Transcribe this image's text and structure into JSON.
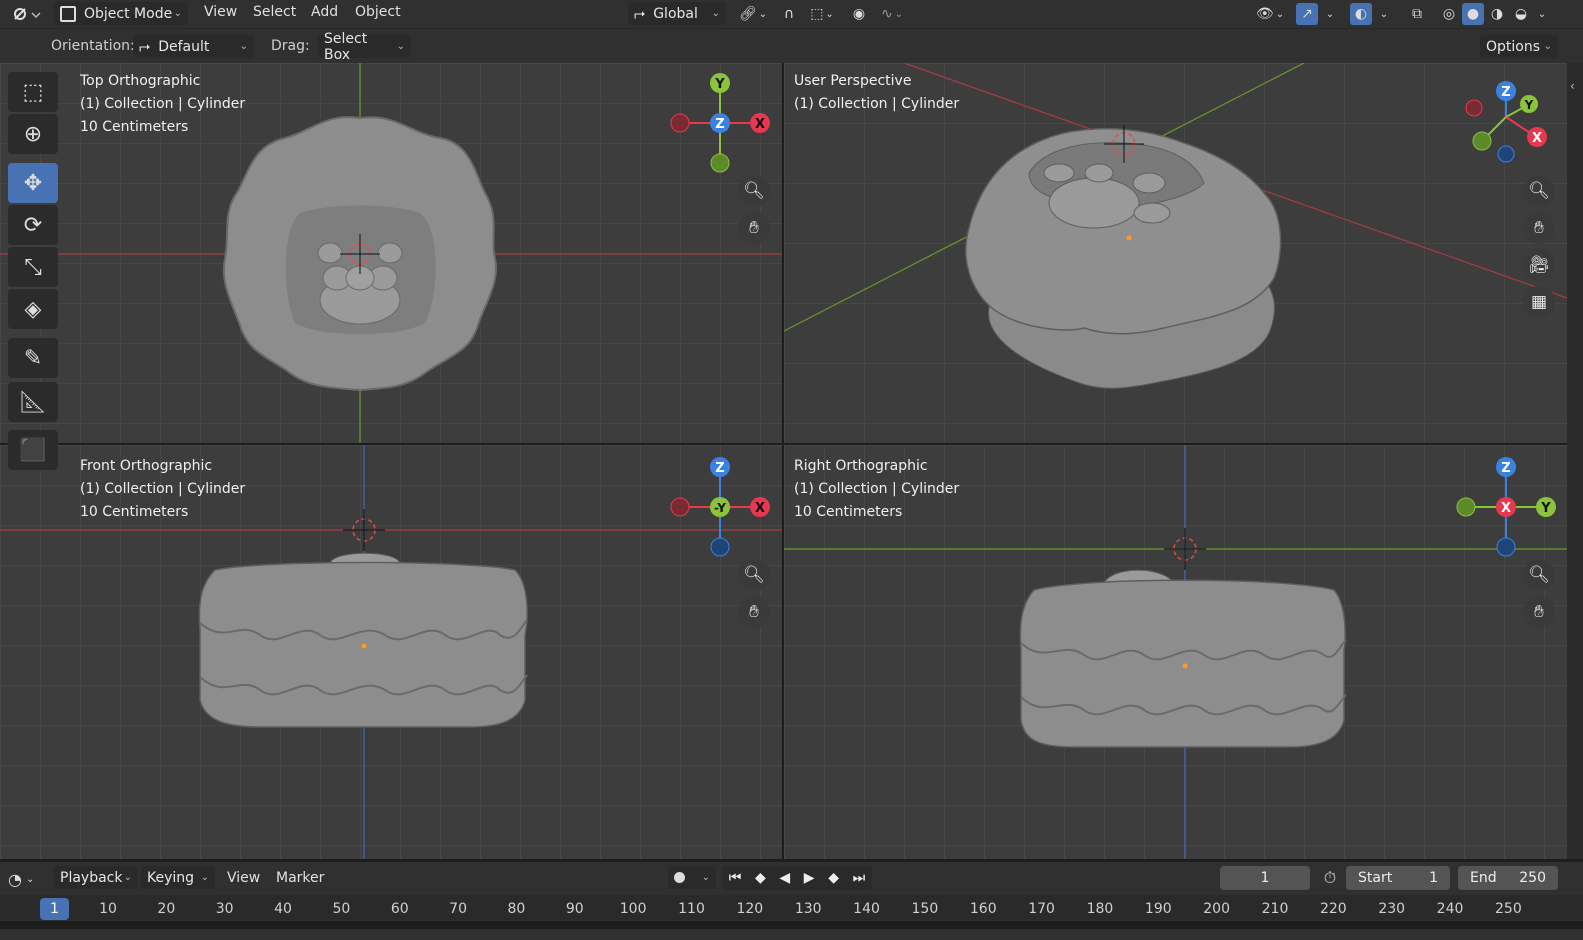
{
  "header": {
    "mode": "Object Mode",
    "menus": [
      "View",
      "Select",
      "Add",
      "Object"
    ],
    "transform_orientation": "Global",
    "icons": [
      "editor-type-icon",
      "object-mode-icon",
      "transform-orientation-icon",
      "pivot-icon",
      "snap-icon",
      "snap-target-icon",
      "proportional-edit-icon",
      "falloff-icon",
      "visibility-icon",
      "gizmo-icon",
      "overlay-icon",
      "xray-icon",
      "wireframe-shading-icon",
      "solid-shading-icon",
      "material-shading-icon",
      "rendered-shading-icon"
    ]
  },
  "tool_settings": {
    "orientation_label": "Orientation:",
    "orientation_value": "Default",
    "drag_label": "Drag:",
    "drag_value": "Select Box",
    "options_label": "Options"
  },
  "toolbar": {
    "tools": [
      "select-box-icon",
      "cursor-icon",
      "move-icon",
      "rotate-icon",
      "scale-icon",
      "transform-icon",
      "annotate-icon",
      "measure-icon",
      "add-cube-icon"
    ],
    "active": "move-icon"
  },
  "viewports": {
    "top": {
      "title": "Top Orthographic",
      "collection": "(1) Collection | Cylinder",
      "scale": "10 Centimeters"
    },
    "persp": {
      "title": "User Perspective",
      "collection": "(1) Collection | Cylinder"
    },
    "front": {
      "title": "Front Orthographic",
      "collection": "(1) Collection | Cylinder",
      "scale": "10 Centimeters"
    },
    "right": {
      "title": "Right Orthographic",
      "collection": "(1) Collection | Cylinder",
      "scale": "10 Centimeters"
    }
  },
  "gizmo_axes": {
    "top": {
      "up": "Y",
      "center": "Z",
      "right": "X"
    },
    "front": {
      "up": "Z",
      "center": "-Y",
      "right": "X"
    },
    "right": {
      "up": "Z",
      "center": "X",
      "right": "Y"
    },
    "persp": {
      "a": "Z",
      "b": "Y",
      "c": "X"
    }
  },
  "axis_colors": {
    "x": "#e8384f",
    "y": "#8bc43a",
    "z": "#3b82e0"
  },
  "timeline": {
    "menus": [
      "Playback",
      "Keying",
      "View",
      "Marker"
    ],
    "current_frame": "1",
    "start_label": "Start",
    "start_value": "1",
    "end_label": "End",
    "end_value": "250",
    "ruler_current": "1",
    "ruler_ticks": [
      "10",
      "20",
      "30",
      "40",
      "50",
      "60",
      "70",
      "80",
      "90",
      "100",
      "110",
      "120",
      "130",
      "140",
      "150",
      "160",
      "170",
      "180",
      "190",
      "200",
      "210",
      "220",
      "230",
      "240",
      "250"
    ]
  }
}
